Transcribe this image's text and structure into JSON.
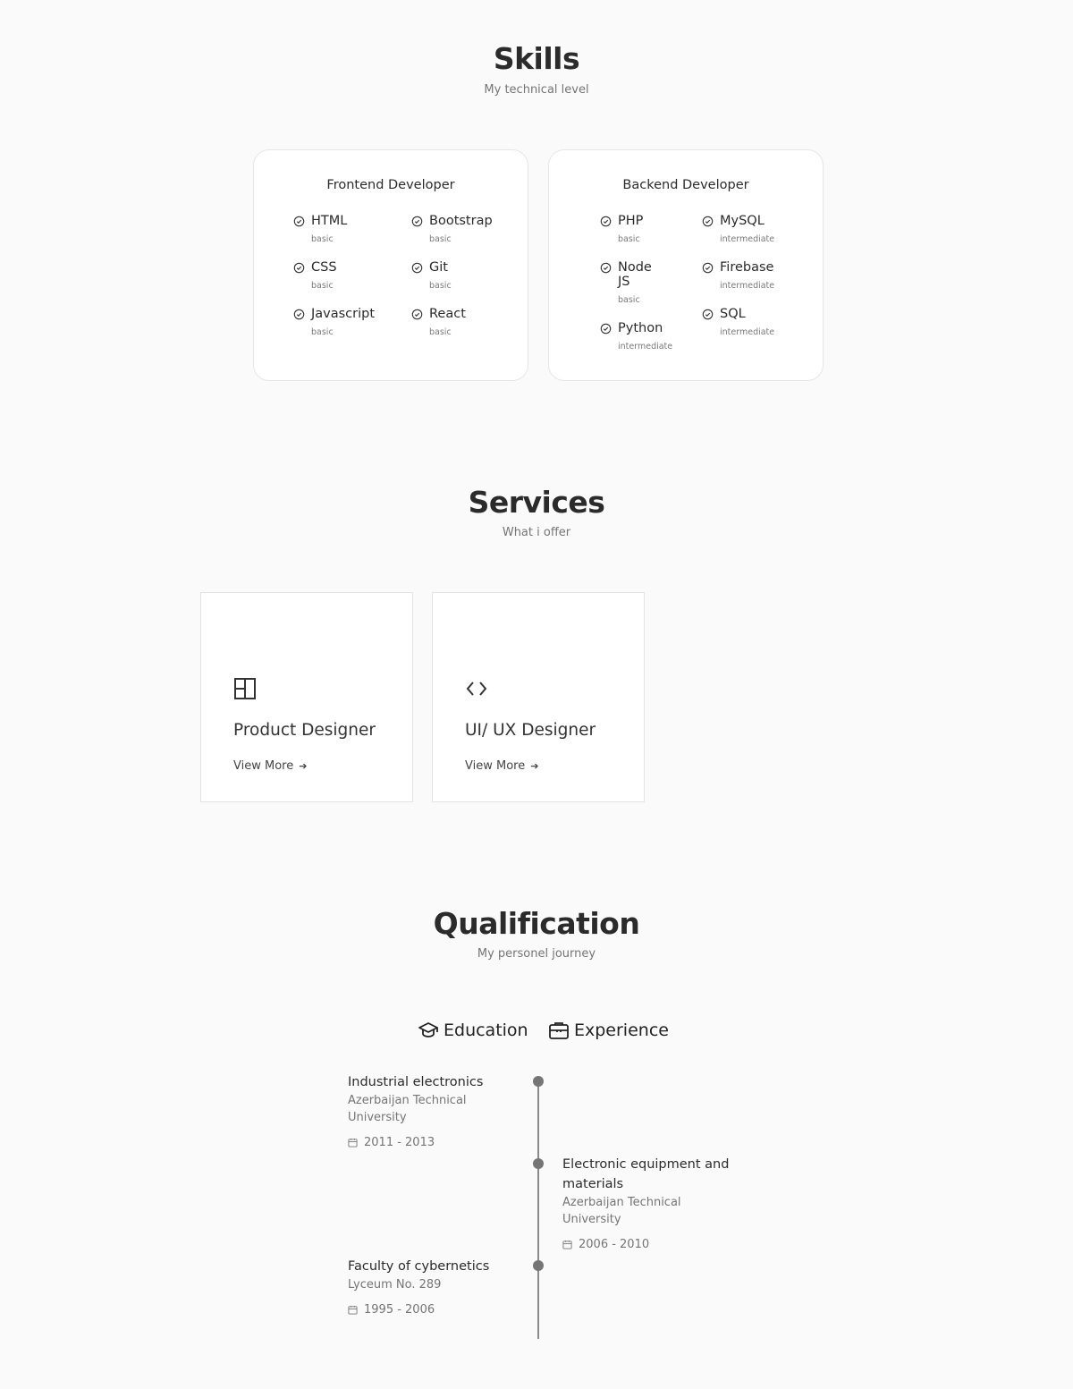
{
  "skills": {
    "title": "Skills",
    "subtitle": "My technical level",
    "frontend": {
      "title": "Frontend Developer",
      "items": [
        {
          "name": "HTML",
          "level": "basic"
        },
        {
          "name": "Bootstrap",
          "level": "basic"
        },
        {
          "name": "CSS",
          "level": "basic"
        },
        {
          "name": "Git",
          "level": "basic"
        },
        {
          "name": "Javascript",
          "level": "basic"
        },
        {
          "name": "React",
          "level": "basic"
        }
      ]
    },
    "backend": {
      "title": "Backend Developer",
      "items": [
        {
          "name": "PHP",
          "level": "basic"
        },
        {
          "name": "MySQL",
          "level": "intermediate"
        },
        {
          "name": "Node",
          "name2": "JS",
          "level": "basic"
        },
        {
          "name": "Firebase",
          "level": "intermediate"
        },
        {
          "name": "Python",
          "level": "intermediate"
        },
        {
          "name": "SQL",
          "level": "intermediate"
        }
      ]
    }
  },
  "services": {
    "title": "Services",
    "subtitle": "What i offer",
    "cards": [
      {
        "title": "Product Designer",
        "link": "View More",
        "icon": "layout-icon"
      },
      {
        "title": "UI/ UX Designer",
        "link": "View More",
        "icon": "code-icon"
      }
    ]
  },
  "qualification": {
    "title": "Qualification",
    "subtitle": "My personel journey",
    "tabs": [
      {
        "label": "Education",
        "icon": "graduation-cap-icon"
      },
      {
        "label": "Experience",
        "icon": "briefcase-icon"
      }
    ],
    "entries": [
      {
        "title": "Industrial electronics",
        "subtitle": "Azerbaijan Technical University",
        "date": "2011 - 2013"
      },
      {
        "title": "Electronic equipment and materials",
        "subtitle": "Azerbaijan Technical University",
        "date": "2006 - 2010"
      },
      {
        "title": "Faculty of cybernetics",
        "subtitle": "Lyceum No. 289",
        "date": "1995 - 2006"
      }
    ]
  }
}
